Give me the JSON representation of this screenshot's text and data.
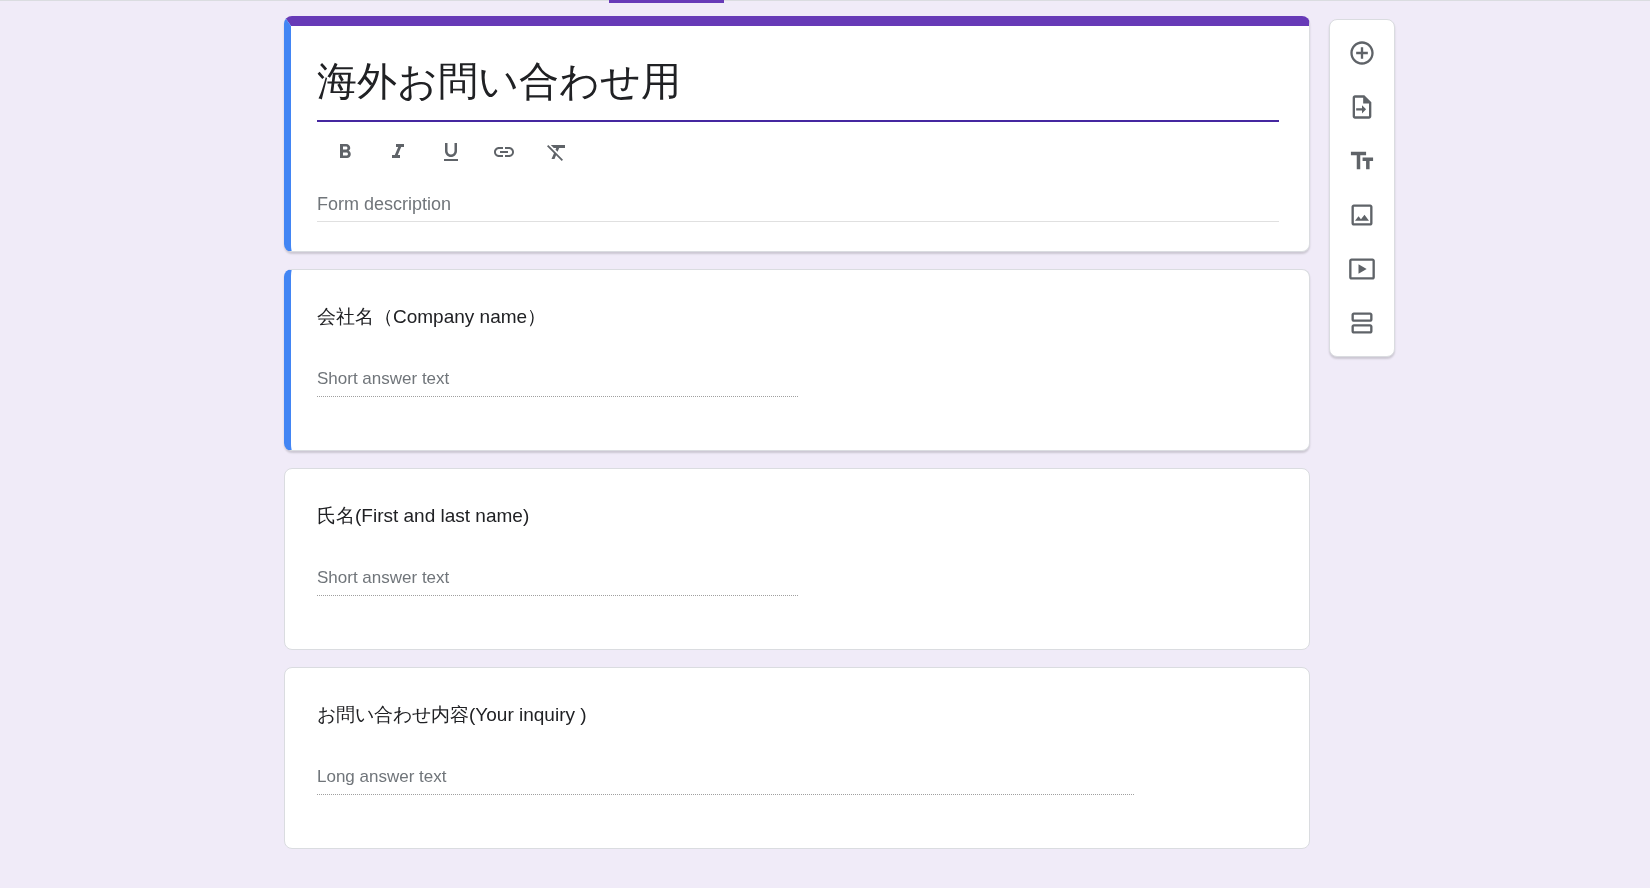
{
  "form": {
    "title": "海外お問い合わせ用",
    "selected": true,
    "toolbar": [
      {
        "kind": "bold"
      },
      {
        "kind": "italic"
      },
      {
        "kind": "underline"
      },
      {
        "kind": "link"
      },
      {
        "kind": "clear"
      }
    ],
    "description": {
      "placeholder": "Form description"
    }
  },
  "questions": [
    {
      "title": "会社名（Company name）",
      "kind": "short",
      "placeholder": "Short answer text",
      "selected": true
    },
    {
      "title": "氏名(First and last name)",
      "kind": "short",
      "placeholder": "Short answer text",
      "selected": false
    },
    {
      "title": "お問い合わせ内容(Your inquiry )",
      "kind": "long",
      "placeholder": "Long answer text",
      "selected": false
    }
  ],
  "side_toolbar": [
    {
      "kind": "add-question"
    },
    {
      "kind": "import"
    },
    {
      "kind": "title"
    },
    {
      "kind": "image"
    },
    {
      "kind": "video"
    },
    {
      "kind": "section"
    }
  ]
}
